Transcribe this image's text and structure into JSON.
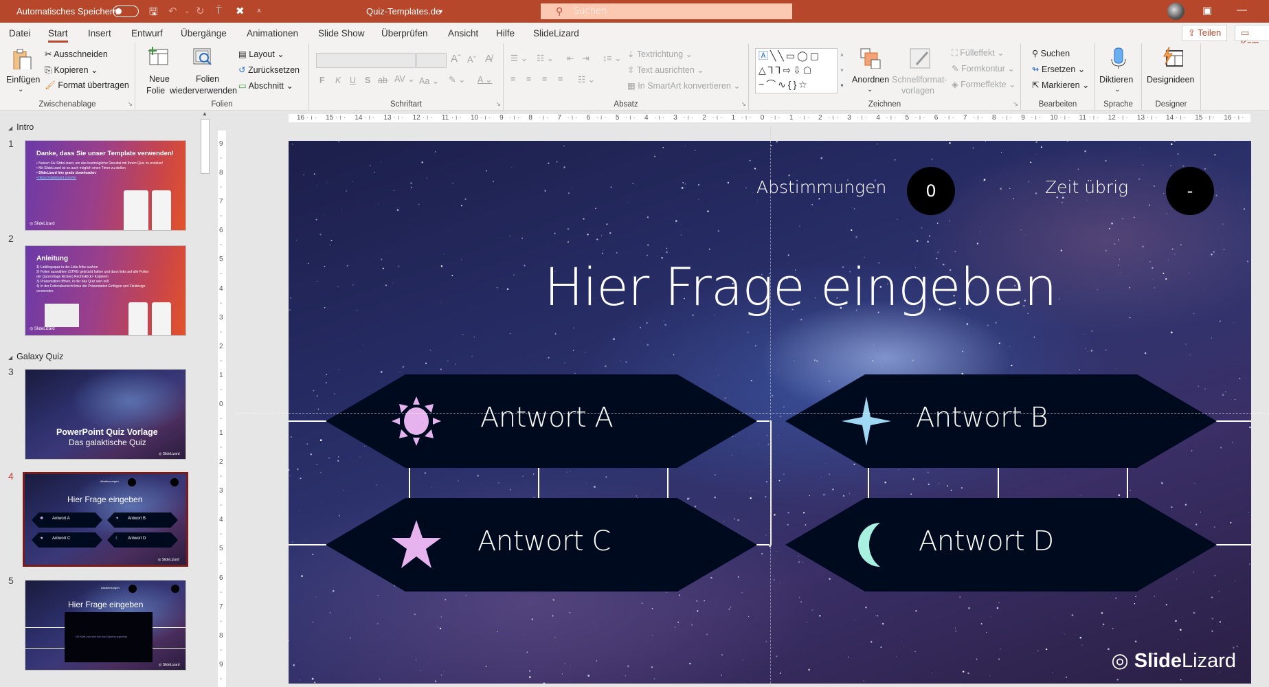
{
  "titlebar": {
    "autosave_label": "Automatisches Speichern",
    "autosave_on": false,
    "document_title": "Quiz-Templates.de",
    "search_placeholder": "Suchen"
  },
  "tabs": [
    "Datei",
    "Start",
    "Insert",
    "Entwurf",
    "Übergänge",
    "Animationen",
    "Slide Show",
    "Überprüfen",
    "Ansicht",
    "Hilfe",
    "SlideLizard"
  ],
  "active_tab": "Start",
  "actions": {
    "share": "Teilen",
    "comments": "Kom"
  },
  "ribbon": {
    "clipboard": {
      "label": "Zwischenablage",
      "paste": "Einfügen",
      "cut": "Ausschneiden",
      "copy": "Kopieren",
      "format_painter": "Format übertragen"
    },
    "slides": {
      "label": "Folien",
      "new_slide_1": "Neue",
      "new_slide_2": "Folie",
      "reuse_1": "Folien",
      "reuse_2": "wiederverwenden",
      "layout": "Layout",
      "reset": "Zurücksetzen",
      "section": "Abschnitt"
    },
    "font": {
      "label": "Schriftart",
      "bold": "F",
      "italic": "K",
      "underline": "U",
      "shadow": "S",
      "strike": "ab",
      "spacing": "AV",
      "case": "Aa"
    },
    "paragraph": {
      "label": "Absatz",
      "text_direction": "Textrichtung",
      "align_text": "Text ausrichten",
      "smartart": "In SmartArt konvertieren"
    },
    "drawing": {
      "label": "Zeichnen",
      "arrange": "Anordnen",
      "quick_styles_1": "Schnellformat-",
      "quick_styles_2": "vorlagen",
      "fill": "Fülleffekt",
      "outline": "Formkontur",
      "effects": "Formeffekte"
    },
    "editing": {
      "label": "Bearbeiten",
      "find": "Suchen",
      "replace": "Ersetzen",
      "select": "Markieren"
    },
    "voice": {
      "label": "Sprache",
      "dictate": "Diktieren"
    },
    "designer": {
      "label": "Designer",
      "design_ideas": "Designideen"
    }
  },
  "slide_panel": {
    "sections": [
      {
        "name": "Intro"
      },
      {
        "name": "Galaxy Quiz"
      }
    ],
    "slides": [
      {
        "number": "1",
        "title": "Danke, dass Sie unser Template verwenden!",
        "lines": [
          "• Nutzen Sie SlideLizard, um das bestmögliche Resultat mit Ihrem Quiz zu erzielen!",
          "• Mit SlideLizard ist es auch möglich einen Timer zu stellen",
          "• SlideLizard hier gratis downloaden:",
          "• https://slidelizard.com/en"
        ]
      },
      {
        "number": "2",
        "title": "Anleitung",
        "lines": [
          "1) Lieblingsquiz in der Liste links suchen",
          "2) Folien auswählen (STRG gedrückt halten und dann links auf alle Folien der Quizvorlage klicken) Rechtsklick> Kopieren",
          "3) Präsentation öffnen, in der das Quiz sein soll",
          "4) In der Folienübersicht links der Präsentation Einfügen und Zieldesign verwenden."
        ]
      },
      {
        "number": "3",
        "title": "PowerPoint Quiz Vorlage",
        "subtitle": "Das galaktische Quiz"
      },
      {
        "number": "4",
        "title": "Hier Frage eingeben",
        "selected": true,
        "answers": [
          "Antwort A",
          "Antwort B",
          "Antwort C",
          "Antwort D"
        ]
      },
      {
        "number": "5",
        "title": "Hier Frage eingeben",
        "note": "Mit SlideLizard wird hier das Ergebnis angezeigt"
      }
    ]
  },
  "ruler": {
    "horizontal": [
      "16",
      "15",
      "14",
      "13",
      "12",
      "11",
      "10",
      "9",
      "8",
      "7",
      "6",
      "5",
      "4",
      "3",
      "2",
      "1",
      "0",
      "1",
      "2",
      "3",
      "4",
      "5",
      "6",
      "7",
      "8",
      "9",
      "10",
      "11",
      "12",
      "13",
      "14",
      "15",
      "16"
    ],
    "vertical": [
      "9",
      "8",
      "7",
      "6",
      "5",
      "4",
      "3",
      "2",
      "1",
      "0",
      "1",
      "2",
      "3",
      "4",
      "5",
      "6",
      "7",
      "8",
      "9"
    ]
  },
  "slide": {
    "votes_label": "Abstimmungen",
    "votes_value": "0",
    "time_label": "Zeit übrig",
    "time_value": "-",
    "question": "Hier Frage eingeben",
    "answers": [
      {
        "label": "Antwort A",
        "icon": "sun-icon",
        "color": "#e6b3ef"
      },
      {
        "label": "Antwort B",
        "icon": "four-point-star-icon",
        "color": "#9fd8f2"
      },
      {
        "label": "Antwort C",
        "icon": "star-icon",
        "color": "#e6b3ef"
      },
      {
        "label": "Antwort D",
        "icon": "crescent-moon-icon",
        "color": "#a8f0e0"
      }
    ],
    "logo_bold": "Slide",
    "logo_light": "Lizard"
  },
  "colors": {
    "accent": "#b7472a",
    "answer_box": "#000a1f",
    "selected_border": "#7b1c1c"
  }
}
